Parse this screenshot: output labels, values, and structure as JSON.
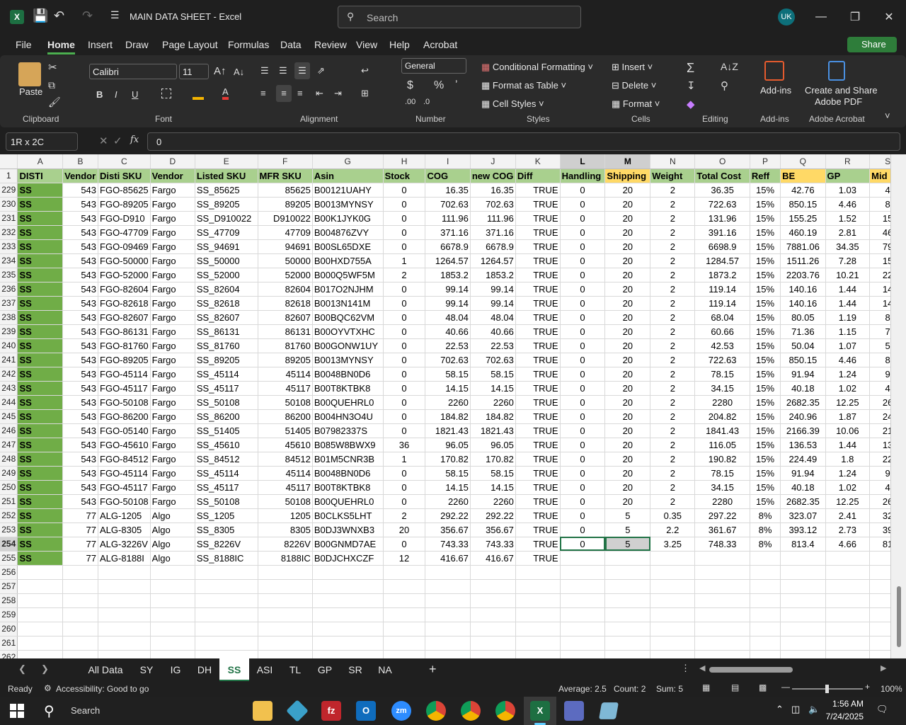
{
  "app": {
    "title": "MAIN DATA SHEET  -  Excel",
    "search_placeholder": "Search",
    "user_initials": "UK"
  },
  "menu": [
    "File",
    "Home",
    "Insert",
    "Draw",
    "Page Layout",
    "Formulas",
    "Data",
    "Review",
    "View",
    "Help",
    "Acrobat"
  ],
  "share_label": "Share",
  "ribbon": {
    "paste": "Paste",
    "clipboard": "Clipboard",
    "font_name": "Calibri",
    "font_size": "11",
    "font_group": "Font",
    "alignment": "Alignment",
    "number_format": "General",
    "number": "Number",
    "cond_fmt": "Conditional Formatting",
    "format_table": "Format as Table",
    "cell_styles": "Cell Styles",
    "styles": "Styles",
    "insert": "Insert",
    "delete": "Delete",
    "format": "Format",
    "cells": "Cells",
    "editing": "Editing",
    "addins_btn": "Add-ins",
    "addins": "Add-ins",
    "acrobat_btn1": "Create and Share",
    "acrobat_btn2": "Adobe PDF",
    "adobe": "Adobe Acrobat"
  },
  "formula_bar": {
    "name_box": "1R x 2C",
    "fx": "fx",
    "value": "0"
  },
  "sheet": {
    "col_letters": [
      "A",
      "B",
      "C",
      "D",
      "E",
      "F",
      "G",
      "H",
      "I",
      "J",
      "K",
      "L",
      "M",
      "N",
      "O",
      "P",
      "Q",
      "R",
      "S"
    ],
    "headers": [
      "DISTI",
      "Vendor",
      "Disti SKU",
      "Vendor",
      "Listed SKU",
      "MFR SKU",
      "Asin",
      "Stock",
      "COG",
      "new COG",
      "Diff",
      "Handling",
      "Shipping",
      "Weight",
      "Total Cost",
      "Reff",
      "BE",
      "GP",
      "Mid"
    ],
    "rows": [
      [
        "229",
        "SS",
        "543",
        "FGO-85625",
        "Fargo",
        "SS_85625",
        "85625",
        "B00121UAHY",
        "0",
        "16.35",
        "16.35",
        "TRUE",
        "0",
        "20",
        "2",
        "36.35",
        "15%",
        "42.76",
        "1.03",
        "4"
      ],
      [
        "230",
        "SS",
        "543",
        "FGO-89205",
        "Fargo",
        "SS_89205",
        "89205",
        "B0013MYNSY",
        "0",
        "702.63",
        "702.63",
        "TRUE",
        "0",
        "20",
        "2",
        "722.63",
        "15%",
        "850.15",
        "4.46",
        "8"
      ],
      [
        "231",
        "SS",
        "543",
        "FGO-D910",
        "Fargo",
        "SS_D910022",
        "D910022",
        "B00K1JYK0G",
        "0",
        "111.96",
        "111.96",
        "TRUE",
        "0",
        "20",
        "2",
        "131.96",
        "15%",
        "155.25",
        "1.52",
        "15"
      ],
      [
        "232",
        "SS",
        "543",
        "FGO-47709",
        "Fargo",
        "SS_47709",
        "47709",
        "B004876ZVY",
        "0",
        "371.16",
        "371.16",
        "TRUE",
        "0",
        "20",
        "2",
        "391.16",
        "15%",
        "460.19",
        "2.81",
        "46"
      ],
      [
        "233",
        "SS",
        "543",
        "FGO-09469",
        "Fargo",
        "SS_94691",
        "94691",
        "B00SL65DXE",
        "0",
        "6678.9",
        "6678.9",
        "TRUE",
        "0",
        "20",
        "2",
        "6698.9",
        "15%",
        "7881.06",
        "34.35",
        "79"
      ],
      [
        "234",
        "SS",
        "543",
        "FGO-50000",
        "Fargo",
        "SS_50000",
        "50000",
        "B00HXD755A",
        "1",
        "1264.57",
        "1264.57",
        "TRUE",
        "0",
        "20",
        "2",
        "1284.57",
        "15%",
        "1511.26",
        "7.28",
        "15"
      ],
      [
        "235",
        "SS",
        "543",
        "FGO-52000",
        "Fargo",
        "SS_52000",
        "52000",
        "B000Q5WF5M",
        "2",
        "1853.2",
        "1853.2",
        "TRUE",
        "0",
        "20",
        "2",
        "1873.2",
        "15%",
        "2203.76",
        "10.21",
        "22"
      ],
      [
        "236",
        "SS",
        "543",
        "FGO-82604",
        "Fargo",
        "SS_82604",
        "82604",
        "B017O2NJHM",
        "0",
        "99.14",
        "99.14",
        "TRUE",
        "0",
        "20",
        "2",
        "119.14",
        "15%",
        "140.16",
        "1.44",
        "14"
      ],
      [
        "237",
        "SS",
        "543",
        "FGO-82618",
        "Fargo",
        "SS_82618",
        "82618",
        "B0013N141M",
        "0",
        "99.14",
        "99.14",
        "TRUE",
        "0",
        "20",
        "2",
        "119.14",
        "15%",
        "140.16",
        "1.44",
        "14"
      ],
      [
        "238",
        "SS",
        "543",
        "FGO-82607",
        "Fargo",
        "SS_82607",
        "82607",
        "B00BQC62VM",
        "0",
        "48.04",
        "48.04",
        "TRUE",
        "0",
        "20",
        "2",
        "68.04",
        "15%",
        "80.05",
        "1.19",
        "8"
      ],
      [
        "239",
        "SS",
        "543",
        "FGO-86131",
        "Fargo",
        "SS_86131",
        "86131",
        "B00OYVTXHC",
        "0",
        "40.66",
        "40.66",
        "TRUE",
        "0",
        "20",
        "2",
        "60.66",
        "15%",
        "71.36",
        "1.15",
        "7"
      ],
      [
        "240",
        "SS",
        "543",
        "FGO-81760",
        "Fargo",
        "SS_81760",
        "81760",
        "B00GONW1UY",
        "0",
        "22.53",
        "22.53",
        "TRUE",
        "0",
        "20",
        "2",
        "42.53",
        "15%",
        "50.04",
        "1.07",
        "5"
      ],
      [
        "241",
        "SS",
        "543",
        "FGO-89205",
        "Fargo",
        "SS_89205",
        "89205",
        "B0013MYNSY",
        "0",
        "702.63",
        "702.63",
        "TRUE",
        "0",
        "20",
        "2",
        "722.63",
        "15%",
        "850.15",
        "4.46",
        "8"
      ],
      [
        "242",
        "SS",
        "543",
        "FGO-45114",
        "Fargo",
        "SS_45114",
        "45114",
        "B0048BN0D6",
        "0",
        "58.15",
        "58.15",
        "TRUE",
        "0",
        "20",
        "2",
        "78.15",
        "15%",
        "91.94",
        "1.24",
        "9"
      ],
      [
        "243",
        "SS",
        "543",
        "FGO-45117",
        "Fargo",
        "SS_45117",
        "45117",
        "B00T8KTBK8",
        "0",
        "14.15",
        "14.15",
        "TRUE",
        "0",
        "20",
        "2",
        "34.15",
        "15%",
        "40.18",
        "1.02",
        "4"
      ],
      [
        "244",
        "SS",
        "543",
        "FGO-50108",
        "Fargo",
        "SS_50108",
        "50108",
        "B00QUEHRL0",
        "0",
        "2260",
        "2260",
        "TRUE",
        "0",
        "20",
        "2",
        "2280",
        "15%",
        "2682.35",
        "12.25",
        "26"
      ],
      [
        "245",
        "SS",
        "543",
        "FGO-86200",
        "Fargo",
        "SS_86200",
        "86200",
        "B004HN3O4U",
        "0",
        "184.82",
        "184.82",
        "TRUE",
        "0",
        "20",
        "2",
        "204.82",
        "15%",
        "240.96",
        "1.87",
        "24"
      ],
      [
        "246",
        "SS",
        "543",
        "FGO-05140",
        "Fargo",
        "SS_51405",
        "51405",
        "B07982337S",
        "0",
        "1821.43",
        "1821.43",
        "TRUE",
        "0",
        "20",
        "2",
        "1841.43",
        "15%",
        "2166.39",
        "10.06",
        "21"
      ],
      [
        "247",
        "SS",
        "543",
        "FGO-45610",
        "Fargo",
        "SS_45610",
        "45610",
        "B085W8BWX9",
        "36",
        "96.05",
        "96.05",
        "TRUE",
        "0",
        "20",
        "2",
        "116.05",
        "15%",
        "136.53",
        "1.44",
        "13"
      ],
      [
        "248",
        "SS",
        "543",
        "FGO-84512",
        "Fargo",
        "SS_84512",
        "84512",
        "B01M5CNR3B",
        "1",
        "170.82",
        "170.82",
        "TRUE",
        "0",
        "20",
        "2",
        "190.82",
        "15%",
        "224.49",
        "1.8",
        "22"
      ],
      [
        "249",
        "SS",
        "543",
        "FGO-45114",
        "Fargo",
        "SS_45114",
        "45114",
        "B0048BN0D6",
        "0",
        "58.15",
        "58.15",
        "TRUE",
        "0",
        "20",
        "2",
        "78.15",
        "15%",
        "91.94",
        "1.24",
        "9"
      ],
      [
        "250",
        "SS",
        "543",
        "FGO-45117",
        "Fargo",
        "SS_45117",
        "45117",
        "B00T8KTBK8",
        "0",
        "14.15",
        "14.15",
        "TRUE",
        "0",
        "20",
        "2",
        "34.15",
        "15%",
        "40.18",
        "1.02",
        "4"
      ],
      [
        "251",
        "SS",
        "543",
        "FGO-50108",
        "Fargo",
        "SS_50108",
        "50108",
        "B00QUEHRL0",
        "0",
        "2260",
        "2260",
        "TRUE",
        "0",
        "20",
        "2",
        "2280",
        "15%",
        "2682.35",
        "12.25",
        "26"
      ],
      [
        "252",
        "SS",
        "77",
        "ALG-1205",
        "Algo",
        "SS_1205",
        "1205",
        "B0CLKS5LHT",
        "2",
        "292.22",
        "292.22",
        "TRUE",
        "0",
        "5",
        "0.35",
        "297.22",
        "8%",
        "323.07",
        "2.41",
        "32"
      ],
      [
        "253",
        "SS",
        "77",
        "ALG-8305",
        "Algo",
        "SS_8305",
        "8305",
        "B0DJ3WNXB3",
        "20",
        "356.67",
        "356.67",
        "TRUE",
        "0",
        "5",
        "2.2",
        "361.67",
        "8%",
        "393.12",
        "2.73",
        "39"
      ],
      [
        "254",
        "SS",
        "77",
        "ALG-3226V",
        "Algo",
        "SS_8226V",
        "8226V",
        "B00GNMD7AE",
        "0",
        "743.33",
        "743.33",
        "TRUE",
        "0",
        "5",
        "3.25",
        "748.33",
        "8%",
        "813.4",
        "4.66",
        "81"
      ],
      [
        "255",
        "SS",
        "77",
        "ALG-8188I",
        "Algo",
        "SS_8188IC",
        "8188IC",
        "B0DJCHXCZF",
        "12",
        "416.67",
        "416.67",
        "TRUE",
        "",
        "",
        "",
        "",
        "",
        "",
        "",
        ""
      ]
    ],
    "empty_rows": [
      "256",
      "257",
      "258",
      "259",
      "260",
      "261",
      "262"
    ]
  },
  "sheet_tabs": [
    "All Data",
    "SY",
    "IG",
    "DH",
    "SS",
    "ASI",
    "TL",
    "GP",
    "SR",
    "NA"
  ],
  "active_tab": "SS",
  "status": {
    "ready": "Ready",
    "accessibility": "Accessibility: Good to go",
    "average": "Average: 2.5",
    "count": "Count: 2",
    "sum": "Sum: 5",
    "zoom": "100%"
  },
  "taskbar": {
    "search": "Search",
    "time": "1:56 AM",
    "date": "7/24/2025"
  }
}
